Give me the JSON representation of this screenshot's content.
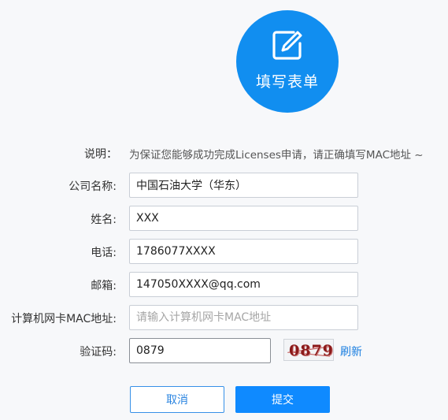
{
  "header": {
    "icon": "edit-form-icon",
    "title": "填写表单",
    "circle_color": "#118ef0"
  },
  "note": {
    "label": "说明：",
    "text": "为保证您能够成功完成Licenses申请，请正确填写MAC地址 ~"
  },
  "form": {
    "company": {
      "label": "公司名称:",
      "value": "中国石油大学（华东）",
      "placeholder": ""
    },
    "name": {
      "label": "姓名:",
      "value": "XXX",
      "placeholder": ""
    },
    "phone": {
      "label": "电话:",
      "value": "1786077XXXX",
      "placeholder": ""
    },
    "email": {
      "label": "邮箱:",
      "value": "147050XXXX@qq.com",
      "placeholder": ""
    },
    "mac": {
      "label": "计算机网卡MAC地址:",
      "value": "",
      "placeholder": "请输入计算机网卡MAC地址"
    },
    "captcha": {
      "label": "验证码:",
      "value": "0879",
      "image_text": "0879",
      "refresh_label": "刷新"
    }
  },
  "buttons": {
    "cancel_label": "取消",
    "submit_label": "提交"
  },
  "colors": {
    "primary": "#0f8aff",
    "link": "#1a7ee0",
    "background": "#f7f8fa"
  }
}
